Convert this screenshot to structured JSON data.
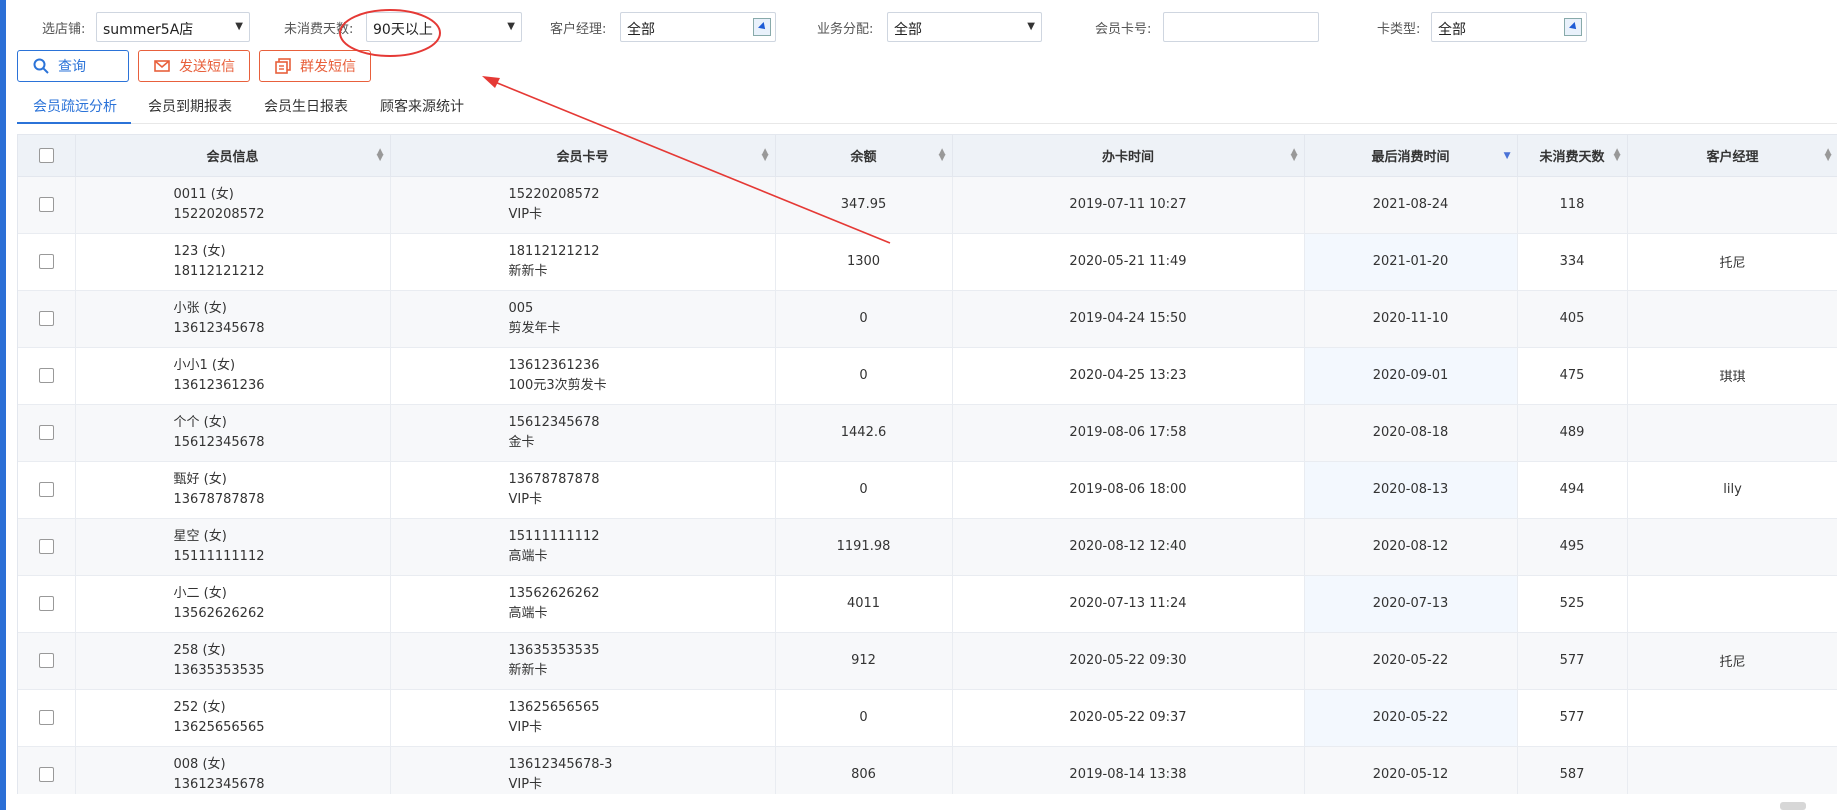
{
  "filters": {
    "store_label": "选店铺:",
    "store_value": "summer5A店",
    "days_label": "未消费天数:",
    "days_value": "90天以上",
    "manager_label": "客户经理:",
    "manager_value": "全部",
    "business_label": "业务分配:",
    "business_value": "全部",
    "card_no_label": "会员卡号:",
    "card_no_value": "",
    "card_type_label": "卡类型:",
    "card_type_value": "全部"
  },
  "actions": {
    "query": "查询",
    "send_sms": "发送短信",
    "group_sms": "群发短信"
  },
  "tabs": [
    {
      "label": "会员疏远分析",
      "active": true
    },
    {
      "label": "会员到期报表",
      "active": false
    },
    {
      "label": "会员生日报表",
      "active": false
    },
    {
      "label": "顾客来源统计",
      "active": false
    }
  ],
  "table": {
    "headers": [
      "会员信息",
      "会员卡号",
      "余额",
      "办卡时间",
      "最后消费时间",
      "未消费天数",
      "客户经理"
    ],
    "sorted_column": "最后消费时间",
    "rows": [
      {
        "name": "0011 (女)",
        "phone": "15220208572",
        "card_no": "15220208572",
        "card_type": "VIP卡",
        "balance": "347.95",
        "open_time": "2019-07-11 10:27",
        "last_time": "2021-08-24",
        "days": "118",
        "manager": ""
      },
      {
        "name": "123 (女)",
        "phone": "18112121212",
        "card_no": "18112121212",
        "card_type": "新新卡",
        "balance": "1300",
        "open_time": "2020-05-21 11:49",
        "last_time": "2021-01-20",
        "days": "334",
        "manager": "托尼"
      },
      {
        "name": "小张 (女)",
        "phone": "13612345678",
        "card_no": "005",
        "card_type": "剪发年卡",
        "balance": "0",
        "open_time": "2019-04-24 15:50",
        "last_time": "2020-11-10",
        "days": "405",
        "manager": ""
      },
      {
        "name": "小小1 (女)",
        "phone": "13612361236",
        "card_no": "13612361236",
        "card_type": "100元3次剪发卡",
        "balance": "0",
        "open_time": "2020-04-25 13:23",
        "last_time": "2020-09-01",
        "days": "475",
        "manager": "琪琪"
      },
      {
        "name": "个个 (女)",
        "phone": "15612345678",
        "card_no": "15612345678",
        "card_type": "金卡",
        "balance": "1442.6",
        "open_time": "2019-08-06 17:58",
        "last_time": "2020-08-18",
        "days": "489",
        "manager": ""
      },
      {
        "name": "甄好 (女)",
        "phone": "13678787878",
        "card_no": "13678787878",
        "card_type": "VIP卡",
        "balance": "0",
        "open_time": "2019-08-06 18:00",
        "last_time": "2020-08-13",
        "days": "494",
        "manager": "lily"
      },
      {
        "name": "星空 (女)",
        "phone": "15111111112",
        "card_no": "15111111112",
        "card_type": "高端卡",
        "balance": "1191.98",
        "open_time": "2020-08-12 12:40",
        "last_time": "2020-08-12",
        "days": "495",
        "manager": ""
      },
      {
        "name": "小二 (女)",
        "phone": "13562626262",
        "card_no": "13562626262",
        "card_type": "高端卡",
        "balance": "4011",
        "open_time": "2020-07-13 11:24",
        "last_time": "2020-07-13",
        "days": "525",
        "manager": ""
      },
      {
        "name": "258 (女)",
        "phone": "13635353535",
        "card_no": "13635353535",
        "card_type": "新新卡",
        "balance": "912",
        "open_time": "2020-05-22 09:30",
        "last_time": "2020-05-22",
        "days": "577",
        "manager": "托尼"
      },
      {
        "name": "252 (女)",
        "phone": "13625656565",
        "card_no": "13625656565",
        "card_type": "VIP卡",
        "balance": "0",
        "open_time": "2020-05-22 09:37",
        "last_time": "2020-05-22",
        "days": "577",
        "manager": ""
      },
      {
        "name": "008 (女)",
        "phone": "13612345678",
        "card_no": "13612345678-3",
        "card_type": "VIP卡",
        "balance": "806",
        "open_time": "2019-08-14 13:38",
        "last_time": "2020-05-12",
        "days": "587",
        "manager": ""
      }
    ]
  },
  "colors": {
    "primary": "#2b73d8",
    "danger": "#e8603c",
    "annotation": "#e53935"
  }
}
